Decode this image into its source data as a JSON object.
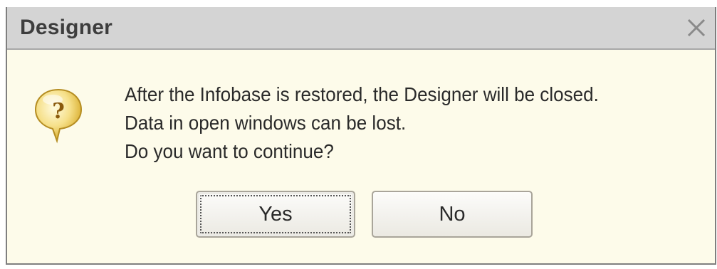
{
  "window": {
    "title": "Designer"
  },
  "icons": {
    "close": "close-icon",
    "message": "question-icon"
  },
  "message": {
    "lines": [
      "After the Infobase is restored, the Designer will be closed.",
      "Data in open windows can be lost.",
      "Do you want to continue?"
    ]
  },
  "buttons": {
    "yes_label": "Yes",
    "no_label": "No"
  },
  "colors": {
    "dialog_background": "#fdfbea",
    "titlebar_background": "#d4d4d4",
    "icon_yellow": "#f2d463"
  }
}
